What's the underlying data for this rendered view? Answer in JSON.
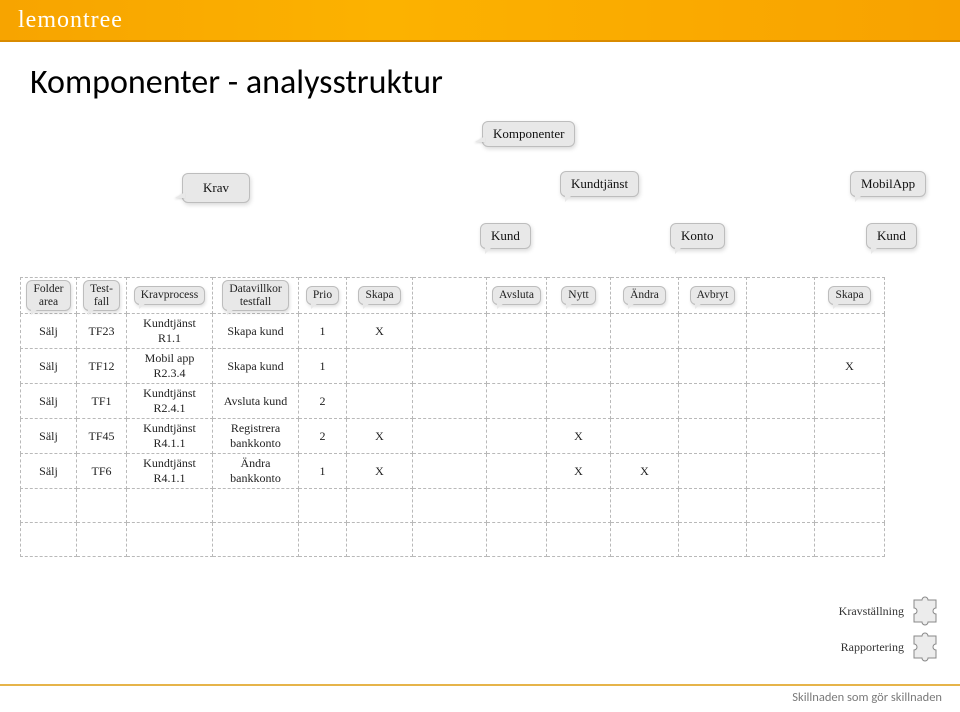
{
  "brand": "lemontree",
  "page_title": "Komponenter - analysstruktur",
  "top_bubbles": {
    "komponenter": "Komponenter",
    "krav": "Krav",
    "kundtjanst": "Kundtjänst",
    "mobilapp": "MobilApp",
    "kund1": "Kund",
    "konto": "Konto",
    "kund2": "Kund"
  },
  "headers": {
    "folder_area": "Folder\narea",
    "testfall": "Test-\nfall",
    "kravprocess": "Kravprocess",
    "datavillkor": "Datavillkor\ntestfall",
    "prio": "Prio",
    "skapa": "Skapa",
    "avsluta": "Avsluta",
    "nytt": "Nytt",
    "andra": "Ändra",
    "avbryt": "Avbryt",
    "skapa2": "Skapa"
  },
  "rows": [
    {
      "folder": "Sälj",
      "tf": "TF23",
      "krav": "Kundtjänst R1.1",
      "dv": "Skapa kund",
      "prio": "1",
      "c5": "X",
      "c6": "",
      "c7": "",
      "c8": "",
      "c9": "",
      "c10": "",
      "c11": "",
      "c12": ""
    },
    {
      "folder": "Sälj",
      "tf": "TF12",
      "krav": "Mobil app R2.3.4",
      "dv": "Skapa kund",
      "prio": "1",
      "c5": "",
      "c6": "",
      "c7": "",
      "c8": "",
      "c9": "",
      "c10": "",
      "c11": "",
      "c12": "X"
    },
    {
      "folder": "Sälj",
      "tf": "TF1",
      "krav": "Kundtjänst R2.4.1",
      "dv": "Avsluta kund",
      "prio": "2",
      "c5": "",
      "c6": "",
      "c7": "",
      "c8": "",
      "c9": "",
      "c10": "",
      "c11": "",
      "c12": ""
    },
    {
      "folder": "Sälj",
      "tf": "TF45",
      "krav": "Kundtjänst R4.1.1",
      "dv": "Registrera bankkonto",
      "prio": "2",
      "c5": "X",
      "c6": "",
      "c7": "",
      "c8": "X",
      "c9": "",
      "c10": "",
      "c11": "",
      "c12": ""
    },
    {
      "folder": "Sälj",
      "tf": "TF6",
      "krav": "Kundtjänst R4.1.1",
      "dv": "Ändra bankkonto",
      "prio": "1",
      "c5": "X",
      "c6": "",
      "c7": "",
      "c8": "X",
      "c9": "X",
      "c10": "",
      "c11": "",
      "c12": ""
    }
  ],
  "chart_data": {
    "type": "table",
    "columns": [
      "Folder area",
      "Testfall",
      "Kravprocess",
      "Datavillkor testfall",
      "Prio",
      "Skapa",
      "Avsluta",
      "Nytt",
      "Ändra",
      "Avbryt",
      "Skapa (MobilApp)"
    ],
    "column_groups": {
      "Kund": [
        "Skapa",
        "Avsluta"
      ],
      "Konto": [
        "Nytt",
        "Ändra",
        "Avbryt"
      ],
      "Kundtjänst": [
        "Kund",
        "Konto"
      ],
      "MobilApp Kund": [
        "Skapa (MobilApp)"
      ]
    },
    "rows": [
      [
        "Sälj",
        "TF23",
        "Kundtjänst R1.1",
        "Skapa kund",
        1,
        "X",
        "",
        "",
        "",
        "",
        ""
      ],
      [
        "Sälj",
        "TF12",
        "Mobil app R2.3.4",
        "Skapa kund",
        1,
        "",
        "",
        "",
        "",
        "",
        "X"
      ],
      [
        "Sälj",
        "TF1",
        "Kundtjänst R2.4.1",
        "Avsluta kund",
        2,
        "",
        "",
        "",
        "",
        "",
        ""
      ],
      [
        "Sälj",
        "TF45",
        "Kundtjänst R4.1.1",
        "Registrera bankkonto",
        2,
        "X",
        "",
        "X",
        "",
        "",
        ""
      ],
      [
        "Sälj",
        "TF6",
        "Kundtjänst R4.1.1",
        "Ändra bankkonto",
        1,
        "X",
        "",
        "X",
        "X",
        "",
        ""
      ]
    ]
  },
  "sidenotes": {
    "kravstallning": "Kravställning",
    "rapportering": "Rapportering"
  },
  "footer": "Skillnaden som gör skillnaden"
}
